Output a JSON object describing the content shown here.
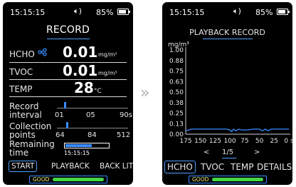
{
  "left_screen": {
    "status": {
      "time": "15:15:15",
      "battery": "85%"
    },
    "title": "RECORD",
    "readings": [
      {
        "label": "HCHO",
        "value": "0.01",
        "unit": "mg/m³"
      },
      {
        "label": "TVOC",
        "value": "0.01",
        "unit": "mg/m³"
      },
      {
        "label": "TEMP",
        "value": "28",
        "unit": "°C"
      }
    ],
    "record_interval": {
      "label_line1": "Record",
      "label_line2": "interval",
      "min": "01",
      "current": "05",
      "max": "90s"
    },
    "collection_points": {
      "label_line1": "Collection",
      "label_line2": "points",
      "min": "64",
      "current": "84",
      "max": "512"
    },
    "remaining_time": {
      "label_line1": "Remaining",
      "label_line2": "time",
      "value": "15:15:15",
      "progress_fraction": 0.62
    },
    "bottom_menu": {
      "start": "START",
      "playback": "PLAYBACK",
      "backlit": "BACK LIT"
    },
    "quality": {
      "label": "GOOD"
    }
  },
  "transition_arrow": "»",
  "right_screen": {
    "status": {
      "time": "15:15:15",
      "battery": "85%"
    },
    "title": "PLAYBACK RECORD",
    "chart_data": {
      "type": "line",
      "ylabel": "mg/m³",
      "ylim": [
        0,
        1.0
      ],
      "y_ticks": [
        "1.00",
        "0.88",
        "0.75",
        "0.63",
        "0.50",
        "0.38",
        "0.25",
        "0.13",
        "0.00"
      ],
      "x_ticks": [
        "175",
        "150",
        "125",
        "100",
        "75",
        "50",
        "25",
        "0 s"
      ],
      "series": [
        {
          "color": "#3a8dff",
          "x": [
            175,
            170,
            165,
            160,
            150,
            140,
            130,
            125,
            115,
            105,
            100,
            97,
            94,
            90,
            85,
            80,
            70,
            60,
            50,
            45,
            40,
            35,
            30,
            20,
            10,
            0
          ],
          "values": [
            0.04,
            0.05,
            0.06,
            0.06,
            0.06,
            0.06,
            0.06,
            0.06,
            0.06,
            0.06,
            0.05,
            0.03,
            0.06,
            0.04,
            0.06,
            0.05,
            0.05,
            0.06,
            0.06,
            0.04,
            0.06,
            0.04,
            0.06,
            0.06,
            0.06,
            0.06
          ]
        }
      ]
    },
    "pager": {
      "prev": "<",
      "page": "1/5",
      "next": ">"
    },
    "bottom_tabs": {
      "hcho": "HCHO",
      "tvoc": "TVOC",
      "temp": "TEMP",
      "details": "DETAILS"
    },
    "quality": {
      "label": "GOOD"
    }
  }
}
